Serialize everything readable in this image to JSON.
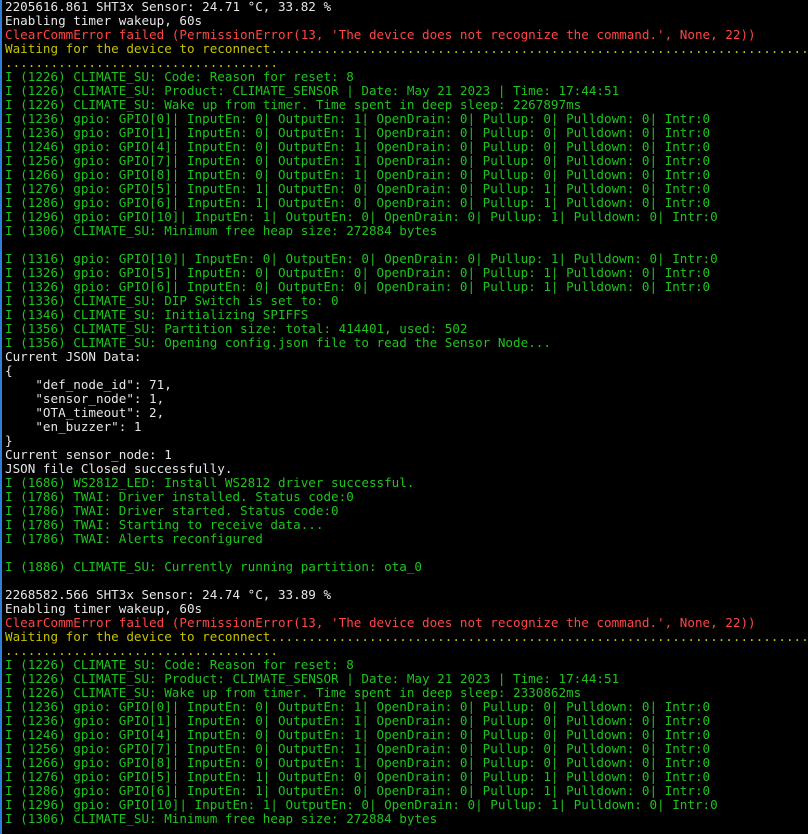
{
  "colors": {
    "white": "#e6e6e6",
    "green": "#1fc31f",
    "red": "#ff4545",
    "yellow": "#c4c400",
    "background": "#000000",
    "accent": "#2f7fd8"
  },
  "lines": [
    {
      "t": "2205616.861 SHT3x Sensor: 24.71 °C, 33.82 %",
      "c": "white"
    },
    {
      "t": "Enabling timer wakeup, 60s",
      "c": "white"
    },
    {
      "t": "ClearCommError failed (PermissionError(13, 'The device does not recognize the command.', None, 22))",
      "c": "red"
    },
    {
      "t": "Waiting for the device to reconnect.......................................................................",
      "c": "yellow"
    },
    {
      "t": "....................................",
      "c": "yellow"
    },
    {
      "t": "I (1226) CLIMATE_SU: Code: Reason for reset: 8",
      "c": "green"
    },
    {
      "t": "I (1226) CLIMATE_SU: Product: CLIMATE_SENSOR | Date: May 21 2023 | Time: 17:44:51",
      "c": "green"
    },
    {
      "t": "I (1226) CLIMATE_SU: Wake up from timer. Time spent in deep sleep: 2267897ms",
      "c": "green"
    },
    {
      "t": "I (1236) gpio: GPIO[0]| InputEn: 0| OutputEn: 1| OpenDrain: 0| Pullup: 0| Pulldown: 0| Intr:0",
      "c": "green"
    },
    {
      "t": "I (1236) gpio: GPIO[1]| InputEn: 0| OutputEn: 1| OpenDrain: 0| Pullup: 0| Pulldown: 0| Intr:0",
      "c": "green"
    },
    {
      "t": "I (1246) gpio: GPIO[4]| InputEn: 0| OutputEn: 1| OpenDrain: 0| Pullup: 0| Pulldown: 0| Intr:0",
      "c": "green"
    },
    {
      "t": "I (1256) gpio: GPIO[7]| InputEn: 0| OutputEn: 1| OpenDrain: 0| Pullup: 0| Pulldown: 0| Intr:0",
      "c": "green"
    },
    {
      "t": "I (1266) gpio: GPIO[8]| InputEn: 0| OutputEn: 1| OpenDrain: 0| Pullup: 0| Pulldown: 0| Intr:0",
      "c": "green"
    },
    {
      "t": "I (1276) gpio: GPIO[5]| InputEn: 1| OutputEn: 0| OpenDrain: 0| Pullup: 1| Pulldown: 0| Intr:0",
      "c": "green"
    },
    {
      "t": "I (1286) gpio: GPIO[6]| InputEn: 1| OutputEn: 0| OpenDrain: 0| Pullup: 1| Pulldown: 0| Intr:0",
      "c": "green"
    },
    {
      "t": "I (1296) gpio: GPIO[10]| InputEn: 1| OutputEn: 0| OpenDrain: 0| Pullup: 1| Pulldown: 0| Intr:0",
      "c": "green"
    },
    {
      "t": "I (1306) CLIMATE_SU: Minimum free heap size: 272884 bytes",
      "c": "green"
    },
    {
      "t": "",
      "c": "white"
    },
    {
      "t": "I (1316) gpio: GPIO[10]| InputEn: 0| OutputEn: 0| OpenDrain: 0| Pullup: 1| Pulldown: 0| Intr:0",
      "c": "green"
    },
    {
      "t": "I (1326) gpio: GPIO[5]| InputEn: 0| OutputEn: 0| OpenDrain: 0| Pullup: 1| Pulldown: 0| Intr:0",
      "c": "green"
    },
    {
      "t": "I (1326) gpio: GPIO[6]| InputEn: 0| OutputEn: 0| OpenDrain: 0| Pullup: 1| Pulldown: 0| Intr:0",
      "c": "green"
    },
    {
      "t": "I (1336) CLIMATE_SU: DIP Switch is set to: 0",
      "c": "green"
    },
    {
      "t": "I (1346) CLIMATE_SU: Initializing SPIFFS",
      "c": "green"
    },
    {
      "t": "I (1356) CLIMATE_SU: Partition size: total: 414401, used: 502",
      "c": "green"
    },
    {
      "t": "I (1356) CLIMATE_SU: Opening config.json file to read the Sensor Node...",
      "c": "green"
    },
    {
      "t": "Current JSON Data:",
      "c": "white"
    },
    {
      "t": "{",
      "c": "white"
    },
    {
      "t": "    \"def_node_id\": 71,",
      "c": "white"
    },
    {
      "t": "    \"sensor_node\": 1,",
      "c": "white"
    },
    {
      "t": "    \"OTA_timeout\": 2,",
      "c": "white"
    },
    {
      "t": "    \"en_buzzer\": 1",
      "c": "white"
    },
    {
      "t": "}",
      "c": "white"
    },
    {
      "t": "Current sensor_node: 1",
      "c": "white"
    },
    {
      "t": "JSON file Closed successfully.",
      "c": "white"
    },
    {
      "t": "I (1686) WS2812_LED: Install WS2812 driver successful.",
      "c": "green"
    },
    {
      "t": "I (1786) TWAI: Driver installed. Status code:0",
      "c": "green"
    },
    {
      "t": "I (1786) TWAI: Driver started. Status code:0",
      "c": "green"
    },
    {
      "t": "I (1786) TWAI: Starting to receive data...",
      "c": "green"
    },
    {
      "t": "I (1786) TWAI: Alerts reconfigured",
      "c": "green"
    },
    {
      "t": "",
      "c": "white"
    },
    {
      "t": "I (1886) CLIMATE_SU: Currently running partition: ota_0",
      "c": "green"
    },
    {
      "t": "",
      "c": "white"
    },
    {
      "t": "2268582.566 SHT3x Sensor: 24.74 °C, 33.89 %",
      "c": "white"
    },
    {
      "t": "Enabling timer wakeup, 60s",
      "c": "white"
    },
    {
      "t": "ClearCommError failed (PermissionError(13, 'The device does not recognize the command.', None, 22))",
      "c": "red"
    },
    {
      "t": "Waiting for the device to reconnect.......................................................................",
      "c": "yellow"
    },
    {
      "t": "....................................",
      "c": "yellow"
    },
    {
      "t": "I (1226) CLIMATE_SU: Code: Reason for reset: 8",
      "c": "green"
    },
    {
      "t": "I (1226) CLIMATE_SU: Product: CLIMATE_SENSOR | Date: May 21 2023 | Time: 17:44:51",
      "c": "green"
    },
    {
      "t": "I (1226) CLIMATE_SU: Wake up from timer. Time spent in deep sleep: 2330862ms",
      "c": "green"
    },
    {
      "t": "I (1236) gpio: GPIO[0]| InputEn: 0| OutputEn: 1| OpenDrain: 0| Pullup: 0| Pulldown: 0| Intr:0",
      "c": "green"
    },
    {
      "t": "I (1236) gpio: GPIO[1]| InputEn: 0| OutputEn: 1| OpenDrain: 0| Pullup: 0| Pulldown: 0| Intr:0",
      "c": "green"
    },
    {
      "t": "I (1246) gpio: GPIO[4]| InputEn: 0| OutputEn: 1| OpenDrain: 0| Pullup: 0| Pulldown: 0| Intr:0",
      "c": "green"
    },
    {
      "t": "I (1256) gpio: GPIO[7]| InputEn: 0| OutputEn: 1| OpenDrain: 0| Pullup: 0| Pulldown: 0| Intr:0",
      "c": "green"
    },
    {
      "t": "I (1266) gpio: GPIO[8]| InputEn: 0| OutputEn: 1| OpenDrain: 0| Pullup: 0| Pulldown: 0| Intr:0",
      "c": "green"
    },
    {
      "t": "I (1276) gpio: GPIO[5]| InputEn: 1| OutputEn: 0| OpenDrain: 0| Pullup: 1| Pulldown: 0| Intr:0",
      "c": "green"
    },
    {
      "t": "I (1286) gpio: GPIO[6]| InputEn: 1| OutputEn: 0| OpenDrain: 0| Pullup: 1| Pulldown: 0| Intr:0",
      "c": "green"
    },
    {
      "t": "I (1296) gpio: GPIO[10]| InputEn: 1| OutputEn: 0| OpenDrain: 0| Pullup: 1| Pulldown: 0| Intr:0",
      "c": "green"
    },
    {
      "t": "I (1306) CLIMATE_SU: Minimum free heap size: 272884 bytes",
      "c": "green"
    }
  ]
}
